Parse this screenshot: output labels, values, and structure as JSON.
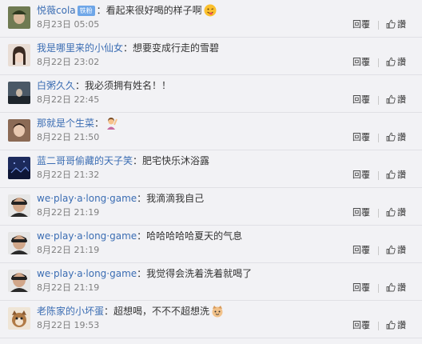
{
  "comments": [
    {
      "user": "悦薇cola",
      "badge": "铁粉",
      "separator": "：",
      "text": "看起来很好喝的样子啊",
      "emoji": "cheeky-face-emoji",
      "time": "8月23日 05:05",
      "reply": "回覆",
      "like": "讚",
      "avatar_color": "#5a6b3c"
    },
    {
      "user": "我是哪里来的小仙女",
      "separator": "：",
      "text": "想要变成行走的雪碧",
      "time": "8月22日 23:02",
      "reply": "回覆",
      "like": "讚",
      "avatar_color": "#c9b8b0"
    },
    {
      "user": "白粥久久",
      "separator": "：",
      "text": "我必须拥有姓名！！",
      "time": "8月22日 22:45",
      "reply": "回覆",
      "like": "讚",
      "avatar_color": "#3a4a5a"
    },
    {
      "user": "那就是个生菜",
      "separator": "：",
      "text": "",
      "emoji": "person-raising-hand-emoji",
      "time": "8月22日 21:50",
      "reply": "回覆",
      "like": "讚",
      "avatar_color": "#7a5a48"
    },
    {
      "user": "蓝二哥哥偷藏的天子笑",
      "separator": "：",
      "text": "肥宅快乐沐浴露",
      "time": "8月22日 21:32",
      "reply": "回覆",
      "like": "讚",
      "avatar_color": "#2a3a7a"
    },
    {
      "user": "we·play·a·long·game",
      "separator": "：",
      "text": "我滴滴我自己",
      "time": "8月22日 21:19",
      "reply": "回覆",
      "like": "讚",
      "avatar_color": "#d8d8d8"
    },
    {
      "user": "we·play·a·long·game",
      "separator": "：",
      "text": "哈哈哈哈哈夏天的气息",
      "time": "8月22日 21:19",
      "reply": "回覆",
      "like": "讚",
      "avatar_color": "#d8d8d8"
    },
    {
      "user": "we·play·a·long·game",
      "separator": "：",
      "text": "我觉得会洗着洗着就喝了",
      "time": "8月22日 21:19",
      "reply": "回覆",
      "like": "讚",
      "avatar_color": "#d8d8d8"
    },
    {
      "user": "老陈家的小坏蛋",
      "separator": "：",
      "text": "超想喝，不不不超想洗",
      "emoji": "cat-face-emoji",
      "time": "8月22日 19:53",
      "reply": "回覆",
      "like": "讚",
      "avatar_color": "#b98a5a"
    }
  ],
  "colors": {
    "user": "#3b6db3",
    "background": "#f2f2f5",
    "time": "#808080"
  },
  "icons": {
    "like": "thumbs-up-icon"
  }
}
